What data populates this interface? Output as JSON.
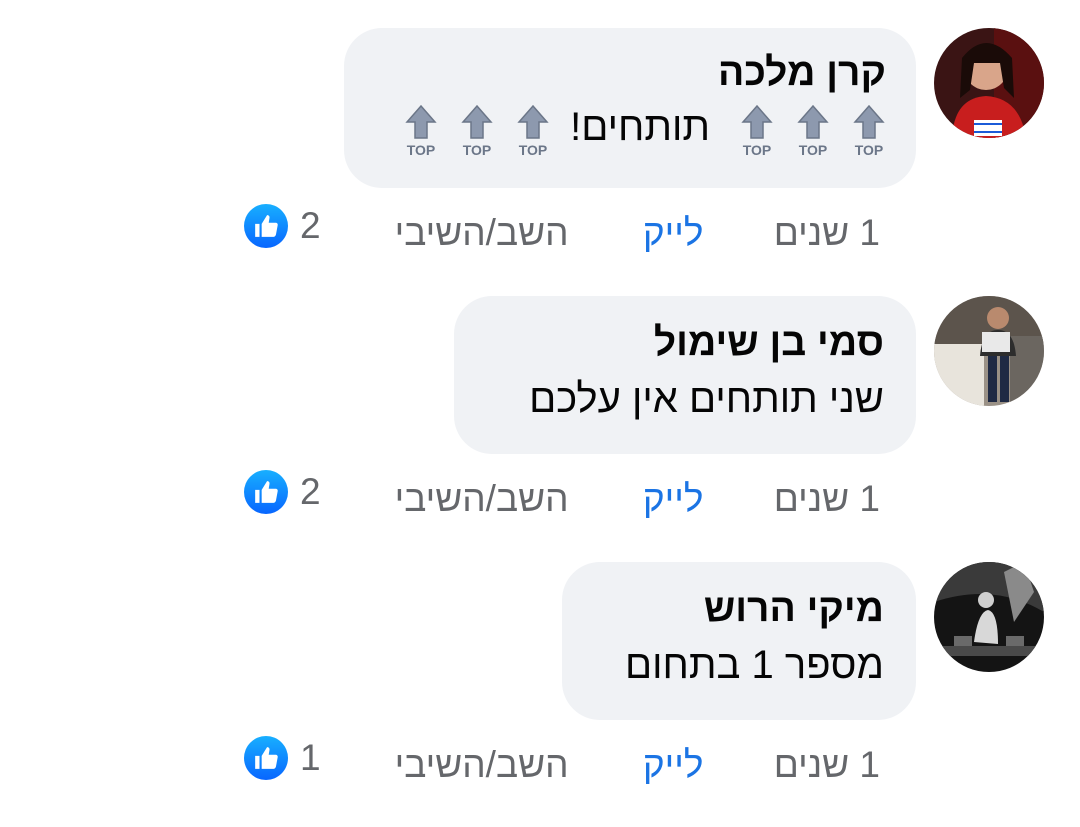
{
  "colors": {
    "bubble": "#f0f2f5",
    "meta_text": "#65676b",
    "like_link": "#1b74e4",
    "like_badge": "#0866ff"
  },
  "comments": [
    {
      "author": "קרן מלכה",
      "text": "תותחים!",
      "emoji_label": "TOP",
      "emoji_name": "top-arrow-emoji",
      "time": "1 שנים",
      "like_label": "לייק",
      "reply_label": "השב/השיבי",
      "reactions": "2"
    },
    {
      "author": "סמי בן שימול",
      "text": "שני תותחים אין עלכם",
      "time": "1 שנים",
      "like_label": "לייק",
      "reply_label": "השב/השיבי",
      "reactions": "2"
    },
    {
      "author": "מיקי הרוש",
      "text": "מספר 1 בתחום",
      "time": "1 שנים",
      "like_label": "לייק",
      "reply_label": "השב/השיבי",
      "reactions": "1"
    }
  ]
}
